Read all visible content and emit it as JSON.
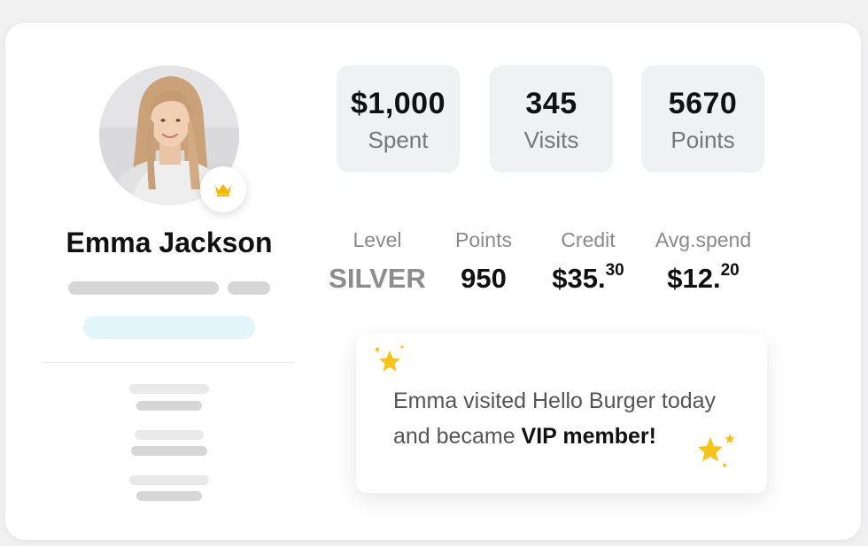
{
  "profile": {
    "name": "Emma Jackson",
    "avatar_icon": "user-photo",
    "badge_icon": "crown-icon",
    "badge_color": "#f5b800"
  },
  "stats": [
    {
      "value": "$1,000",
      "label": "Spent"
    },
    {
      "value": "345",
      "label": "Visits"
    },
    {
      "value": "5670",
      "label": "Points"
    }
  ],
  "details": {
    "level": {
      "label": "Level",
      "value": "SILVER"
    },
    "points": {
      "label": "Points",
      "value": "950"
    },
    "credit": {
      "label": "Credit",
      "main": "$35.",
      "cents": "30"
    },
    "avg_spend": {
      "label": "Avg.spend",
      "main": "$12.",
      "cents": "20"
    }
  },
  "notification": {
    "text_prefix": "Emma visited Hello Burger today and became ",
    "text_bold": "VIP member!",
    "star_color": "#f7c21b"
  }
}
